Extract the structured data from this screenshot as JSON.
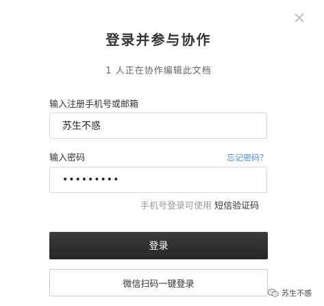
{
  "dialog": {
    "title": "登录并参与协作",
    "subtitle": "1 人正在协作编辑此文档"
  },
  "form": {
    "account_label": "输入注册手机号或邮箱",
    "account_value": "苏生不惑",
    "password_label": "输入密码",
    "forgot_password": "忘记密码？",
    "password_value": "•••••••••",
    "sms_hint": "手机号登录可使用",
    "sms_link": "短信验证码"
  },
  "buttons": {
    "login": "登录",
    "wechat_login": "微信扫码一键登录"
  },
  "watermark": {
    "text": "苏生不惑"
  },
  "icons": {
    "close": "close-icon",
    "wechat": "wechat-icon"
  },
  "colors": {
    "primary_button": "#2e2f30",
    "link": "#4a8bd6"
  }
}
